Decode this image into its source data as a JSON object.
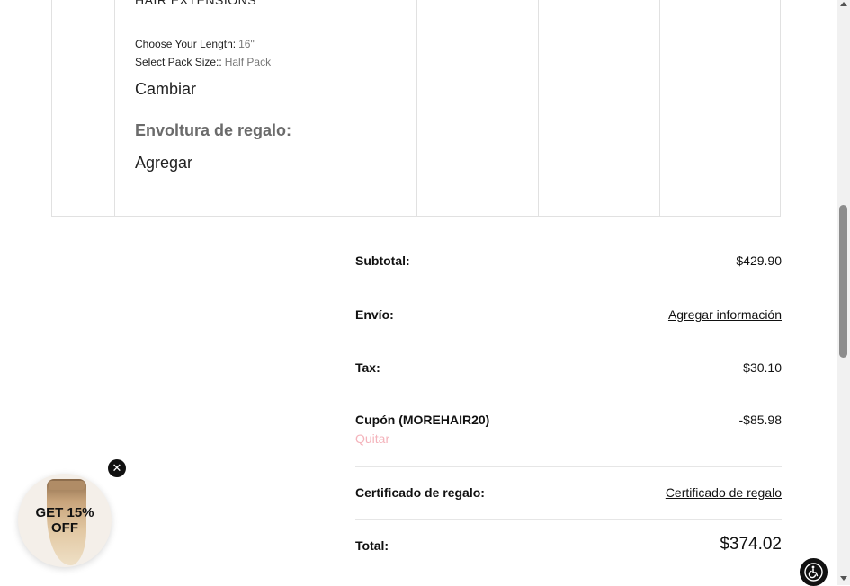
{
  "product": {
    "title": "HAIR EXTENSIONS",
    "options": [
      {
        "label": "Choose Your Length:",
        "value": "16\""
      },
      {
        "label": "Select Pack Size::",
        "value": "Half Pack"
      }
    ],
    "change_label": "Cambiar",
    "gift_wrap_label": "Envoltura de regalo:",
    "gift_wrap_add_label": "Agregar"
  },
  "totals": {
    "subtotal": {
      "label": "Subtotal:",
      "value": "$429.90"
    },
    "shipping": {
      "label": "Envío:",
      "value": "Agregar información"
    },
    "tax": {
      "label": "Tax:",
      "value": "$30.10"
    },
    "coupon": {
      "label": "Cupón (MOREHAIR20)",
      "value": "-$85.98",
      "remove_label": "Quitar"
    },
    "gift_certificate": {
      "label": "Certificado de regalo:",
      "value": "Certificado de regalo"
    },
    "total": {
      "label": "Total:",
      "value": "$374.02"
    }
  },
  "promo": {
    "text_line1": "GET 15%",
    "text_line2": "OFF",
    "close_icon": "close-icon"
  },
  "accessibility": {
    "icon": "accessibility-icon"
  },
  "colors": {
    "remove_link": "#f4b3bb",
    "border": "#e1e1e1"
  }
}
